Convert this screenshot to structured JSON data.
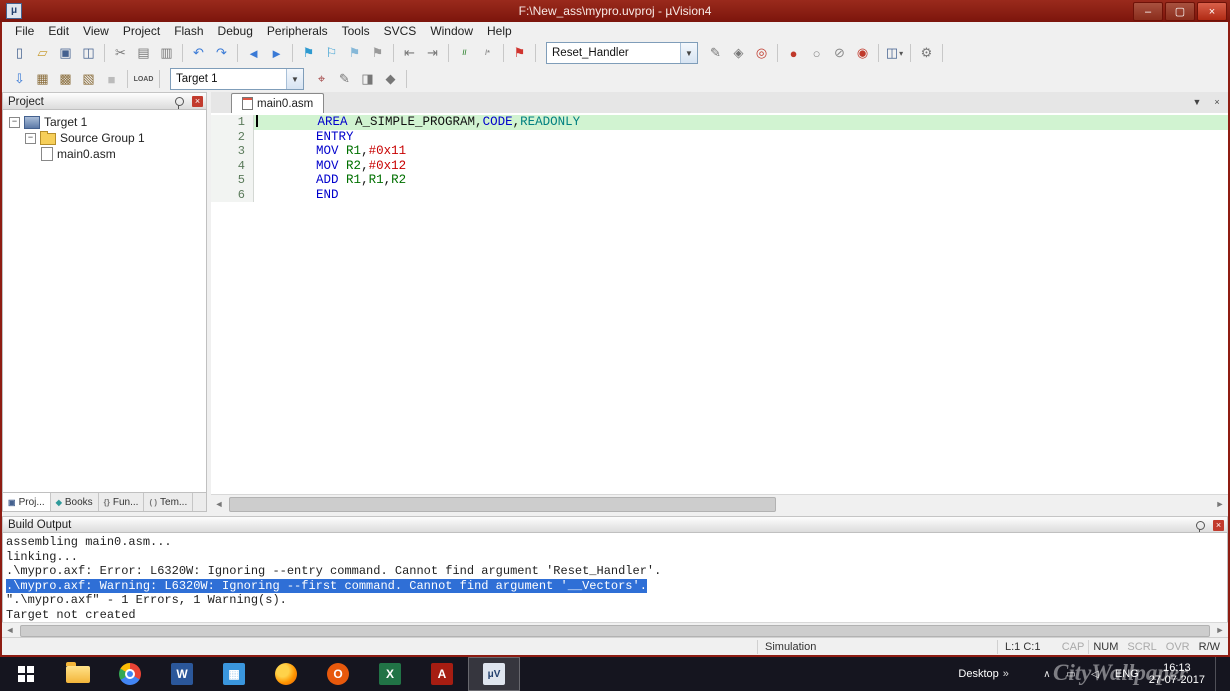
{
  "titlebar": {
    "title": "F:\\New_ass\\mypro.uvproj - µVision4",
    "buttons": {
      "minimize": "–",
      "maximize": "▢",
      "close": "×"
    }
  },
  "menu": {
    "items": [
      "File",
      "Edit",
      "View",
      "Project",
      "Flash",
      "Debug",
      "Peripherals",
      "Tools",
      "SVCS",
      "Window",
      "Help"
    ]
  },
  "toolbar1": {
    "groups_left": [
      [
        {
          "n": "new-file-icon",
          "g": "▯",
          "c": "#44618f"
        },
        {
          "n": "open-file-icon",
          "g": "▱",
          "c": "#c9a03a"
        },
        {
          "n": "save-icon",
          "g": "▣",
          "c": "#44618f"
        },
        {
          "n": "save-all-icon",
          "g": "◫",
          "c": "#44618f"
        }
      ],
      [
        {
          "n": "cut-icon",
          "g": "✂",
          "c": "#777777"
        },
        {
          "n": "copy-icon",
          "g": "▤",
          "c": "#777777"
        },
        {
          "n": "paste-icon",
          "g": "▥",
          "c": "#777777"
        }
      ],
      [
        {
          "n": "undo-icon",
          "g": "↶",
          "c": "#3a7ad6"
        },
        {
          "n": "redo-icon",
          "g": "↷",
          "c": "#3a7ad6"
        }
      ],
      [
        {
          "n": "nav-back-icon",
          "g": "◄",
          "c": "#3a7ad6"
        },
        {
          "n": "nav-forward-icon",
          "g": "►",
          "c": "#3a7ad6"
        }
      ],
      [
        {
          "n": "bookmark-toggle-icon",
          "g": "⚑",
          "c": "#2e9ad0"
        },
        {
          "n": "bookmark-prev-icon",
          "g": "⚐",
          "c": "#2e9ad0"
        },
        {
          "n": "bookmark-next-icon",
          "g": "⚑",
          "c": "#86b8d8"
        },
        {
          "n": "bookmark-clear-icon",
          "g": "⚑",
          "c": "#9a9a9a"
        }
      ],
      [
        {
          "n": "unindent-icon",
          "g": "⇤",
          "c": "#777777"
        },
        {
          "n": "indent-icon",
          "g": "⇥",
          "c": "#777777"
        }
      ],
      [
        {
          "n": "comment-icon",
          "g": "//",
          "c": "#3a8a3a",
          "small": true
        },
        {
          "n": "uncomment-icon",
          "g": "/*",
          "c": "#888888",
          "small": true
        }
      ],
      [
        {
          "n": "run-to-line-icon",
          "g": "⚑",
          "c": "#d0342e"
        }
      ]
    ],
    "combo": {
      "value": "Reset_Handler"
    },
    "groups_right": [
      [
        {
          "n": "browse-info-icon",
          "g": "✎",
          "c": "#777777"
        },
        {
          "n": "symbols-icon",
          "g": "◈",
          "c": "#777777"
        },
        {
          "n": "find-in-files-icon",
          "g": "◎",
          "c": "#c0392b"
        }
      ],
      [
        {
          "n": "insert-breakpoint-icon",
          "g": "●",
          "c": "#c0392b"
        },
        {
          "n": "disable-breakpoint-icon",
          "g": "○",
          "c": "#888888"
        },
        {
          "n": "kill-breakpoints-icon",
          "g": "⊘",
          "c": "#888888"
        },
        {
          "n": "enable-breakpoints-icon",
          "g": "◉",
          "c": "#c0392b"
        }
      ],
      [
        {
          "n": "window-layout-icon",
          "g": "◫",
          "c": "#44618f",
          "caret": true
        }
      ],
      [
        {
          "n": "configure-icon",
          "g": "⚙",
          "c": "#777777"
        }
      ]
    ]
  },
  "toolbar2": {
    "groups_left": [
      [
        {
          "n": "translate-icon",
          "g": "⇩",
          "c": "#3a7ad6"
        },
        {
          "n": "build-icon",
          "g": "▦",
          "c": "#8a6d3b"
        },
        {
          "n": "rebuild-icon",
          "g": "▩",
          "c": "#8a6d3b"
        },
        {
          "n": "batch-build-icon",
          "g": "▧",
          "c": "#8a6d3b"
        },
        {
          "n": "stop-build-icon",
          "g": "■",
          "c": "#bbbbbb"
        }
      ],
      [
        {
          "n": "flash-download-icon",
          "g": "LOAD",
          "c": "#555555",
          "small": true
        }
      ]
    ],
    "combo": {
      "value": "Target 1"
    },
    "groups_right": [
      [
        {
          "n": "target-options-icon",
          "g": "⌖",
          "c": "#a04040"
        },
        {
          "n": "edit-target-icon",
          "g": "✎",
          "c": "#777777"
        },
        {
          "n": "manage-components-icon",
          "g": "◨",
          "c": "#777777"
        },
        {
          "n": "project-items-icon",
          "g": "◆",
          "c": "#777777"
        }
      ]
    ]
  },
  "project_panel": {
    "title": "Project",
    "tree": [
      {
        "label": "Target 1",
        "level": 0,
        "expand": "−",
        "icon": "target"
      },
      {
        "label": "Source Group 1",
        "level": 1,
        "expand": "−",
        "icon": "folder"
      },
      {
        "label": "main0.asm",
        "level": 2,
        "expand": "",
        "icon": "file"
      }
    ],
    "tabs": [
      {
        "label": "Proj...",
        "g": "▣",
        "gc": "#44618f",
        "active": true
      },
      {
        "label": "Books",
        "g": "◆",
        "gc": "#2e9a9a",
        "active": false
      },
      {
        "label": "Fun...",
        "g": "{}",
        "gc": "#777777",
        "active": false
      },
      {
        "label": "Tem...",
        "g": "( )",
        "gc": "#777777",
        "active": false
      }
    ]
  },
  "editor": {
    "tab_label": "main0.asm",
    "doc_buttons": {
      "list": "▼",
      "close": "×"
    },
    "lines": [
      {
        "num": "1",
        "hl": true,
        "caret": true,
        "tokens": [
          [
            "p",
            "        "
          ],
          [
            "k",
            "AREA"
          ],
          [
            "p",
            " A_SIMPLE_PROGRAM,"
          ],
          [
            "k",
            "CODE"
          ],
          [
            "p",
            ","
          ],
          [
            "d",
            "READONLY"
          ]
        ]
      },
      {
        "num": "2",
        "tokens": [
          [
            "p",
            "        "
          ],
          [
            "k",
            "ENTRY"
          ]
        ]
      },
      {
        "num": "3",
        "tokens": [
          [
            "p",
            "        "
          ],
          [
            "k",
            "MOV"
          ],
          [
            "p",
            " "
          ],
          [
            "r",
            "R1"
          ],
          [
            "p",
            ","
          ],
          [
            "n",
            "#0x11"
          ]
        ]
      },
      {
        "num": "4",
        "tokens": [
          [
            "p",
            "        "
          ],
          [
            "k",
            "MOV"
          ],
          [
            "p",
            " "
          ],
          [
            "r",
            "R2"
          ],
          [
            "p",
            ","
          ],
          [
            "n",
            "#0x12"
          ]
        ]
      },
      {
        "num": "5",
        "tokens": [
          [
            "p",
            "        "
          ],
          [
            "k",
            "ADD"
          ],
          [
            "p",
            " "
          ],
          [
            "r",
            "R1"
          ],
          [
            "p",
            ","
          ],
          [
            "r",
            "R1"
          ],
          [
            "p",
            ","
          ],
          [
            "r",
            "R2"
          ]
        ]
      },
      {
        "num": "6",
        "tokens": [
          [
            "p",
            "        "
          ],
          [
            "k",
            "END"
          ]
        ]
      }
    ]
  },
  "build_output": {
    "title": "Build Output",
    "lines": [
      {
        "text": "assembling main0.asm...",
        "sel": false
      },
      {
        "text": "linking...",
        "sel": false
      },
      {
        "text": ".\\mypro.axf: Error: L6320W: Ignoring --entry command. Cannot find argument 'Reset_Handler'.",
        "sel": false
      },
      {
        "text": ".\\mypro.axf: Warning: L6320W: Ignoring --first command. Cannot find argument '__Vectors'.",
        "sel": true
      },
      {
        "text": "\".\\mypro.axf\" - 1 Errors, 1 Warning(s).",
        "sel": false
      },
      {
        "text": "Target not created",
        "sel": false
      }
    ]
  },
  "statusbar": {
    "mode": "Simulation",
    "cursor": "L:1 C:1",
    "flags": [
      {
        "label": "CAP",
        "on": false
      },
      {
        "label": "NUM",
        "on": true
      },
      {
        "label": "SCRL",
        "on": false
      },
      {
        "label": "OVR",
        "on": false
      },
      {
        "label": "R/W",
        "on": true
      }
    ]
  },
  "taskbar": {
    "apps": [
      {
        "n": "start-button",
        "kind": "start"
      },
      {
        "n": "file-explorer-icon",
        "kind": "folder"
      },
      {
        "n": "chrome-icon",
        "kind": "chrome"
      },
      {
        "n": "word-icon",
        "kind": "sq",
        "bg": "#2b579a",
        "t": "W"
      },
      {
        "n": "app-icon-blue",
        "kind": "sq",
        "bg": "#3a96dd",
        "t": "▦"
      },
      {
        "n": "firefox-icon",
        "kind": "ff"
      },
      {
        "n": "office-icon",
        "kind": "round",
        "bg": "#e8590c",
        "t": "O"
      },
      {
        "n": "excel-icon",
        "kind": "sq",
        "bg": "#217346",
        "t": "X"
      },
      {
        "n": "acrobat-icon",
        "kind": "sq",
        "bg": "#a61d12",
        "t": "A"
      },
      {
        "n": "uvision-icon",
        "kind": "sq",
        "bg": "#dfe5ee",
        "fg": "#23406e",
        "t": "μV",
        "active": true
      }
    ],
    "tray": {
      "desktop": "Desktop",
      "chevrons": "»",
      "icons": [
        {
          "n": "hidden-icons-chevron",
          "g": "∧"
        },
        {
          "n": "battery-icon",
          "g": "▭"
        },
        {
          "n": "volume-icon",
          "g": "◁"
        }
      ],
      "lang": "ENG",
      "time": "16:13",
      "date": "27-07-2017"
    },
    "watermark": "CityWallpaper"
  }
}
